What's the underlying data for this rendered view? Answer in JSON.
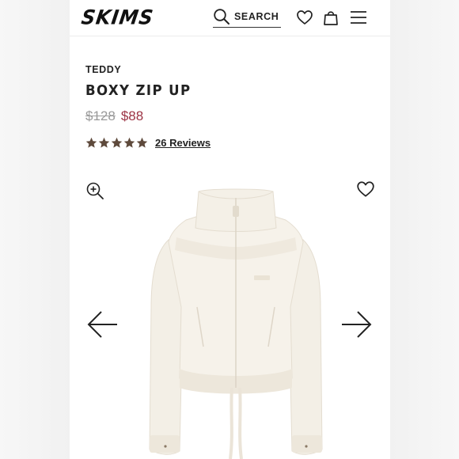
{
  "header": {
    "logo": "SKIMS",
    "search_label": "SEARCH",
    "icons": [
      "search-icon",
      "heart-icon",
      "bag-icon",
      "menu-icon"
    ]
  },
  "product": {
    "category": "TEDDY",
    "title": "BOXY ZIP UP",
    "price_original": "$128",
    "price_sale": "$88",
    "rating": 5,
    "reviews_label": "26 Reviews"
  },
  "gallery": {
    "icons": [
      "zoom-icon",
      "favorite-icon",
      "arrow-left-icon",
      "arrow-right-icon"
    ]
  },
  "colors": {
    "sale_price": "#9c3344",
    "star": "#5e4a3c",
    "text": "#222222",
    "garment": "#f3efe6"
  }
}
